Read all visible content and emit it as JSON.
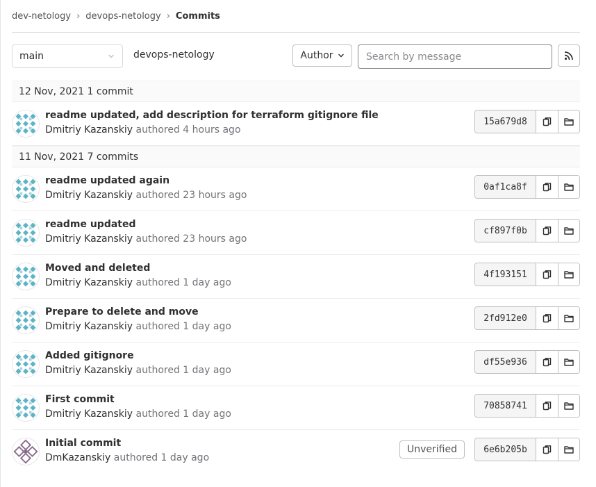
{
  "breadcrumb": {
    "items": [
      "dev-netology",
      "devops-netology"
    ],
    "current": "Commits"
  },
  "toolbar": {
    "branch": "main",
    "project": "devops-netology",
    "author_label": "Author",
    "search_placeholder": "Search by message"
  },
  "days": [
    {
      "header": "12 Nov, 2021 1 commit",
      "commits": [
        {
          "title": "readme updated, add description for terraform gitignore file",
          "author": "Dmitriy Kazanskiy",
          "verb": " authored 4 hours ago",
          "sha": "15a679d8"
        }
      ]
    },
    {
      "header": "11 Nov, 2021 7 commits",
      "commits": [
        {
          "title": "readme updated again",
          "author": "Dmitriy Kazanskiy",
          "verb": " authored 23 hours ago",
          "sha": "0af1ca8f"
        },
        {
          "title": "readme updated",
          "author": "Dmitriy Kazanskiy",
          "verb": " authored 23 hours ago",
          "sha": "cf897f0b"
        },
        {
          "title": "Moved and deleted",
          "author": "Dmitriy Kazanskiy",
          "verb": " authored 1 day ago",
          "sha": "4f193151"
        },
        {
          "title": "Prepare to delete and move",
          "author": "Dmitriy Kazanskiy",
          "verb": " authored 1 day ago",
          "sha": "2fd912e0"
        },
        {
          "title": "Added gitignore",
          "author": "Dmitriy Kazanskiy",
          "verb": " authored 1 day ago",
          "sha": "df55e936"
        },
        {
          "title": "First commit",
          "author": "Dmitriy Kazanskiy",
          "verb": " authored 1 day ago",
          "sha": "70858741"
        },
        {
          "title": "Initial commit",
          "author": "DmKazanskiy",
          "verb": " authored 1 day ago",
          "sha": "6e6b205b",
          "badge": "Unverified"
        }
      ]
    }
  ],
  "colors": {
    "avatar_teal": "#5fb3c4",
    "avatar_purple": "#8b6b8e"
  },
  "icons": {
    "copy": "copy-icon",
    "browse": "folder-icon",
    "rss": "rss-icon",
    "dropdown": "chevron-down-icon"
  }
}
